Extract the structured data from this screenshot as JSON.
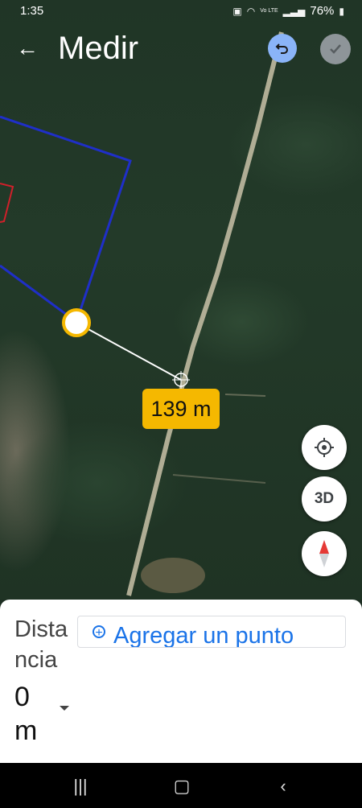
{
  "status": {
    "time": "1:35",
    "battery": "76%",
    "network": "Vo LTE"
  },
  "header": {
    "title": "Medir"
  },
  "measurement": {
    "label": "139 m"
  },
  "controls": {
    "three_d": "3D"
  },
  "sheet": {
    "distance_title": "Distancia",
    "distance_value": "0",
    "distance_unit": "m",
    "add_point": "Agregar un punto"
  },
  "icons": {
    "back": "arrow-back-icon",
    "undo": "undo-icon",
    "done": "check-icon",
    "locate": "my-location-icon",
    "compass": "compass-icon",
    "add": "add-circle-icon"
  },
  "colors": {
    "accent": "#1a73e8",
    "label": "#f5b800",
    "boundary_blue": "#1f2fc8",
    "boundary_red": "#d0202a"
  }
}
